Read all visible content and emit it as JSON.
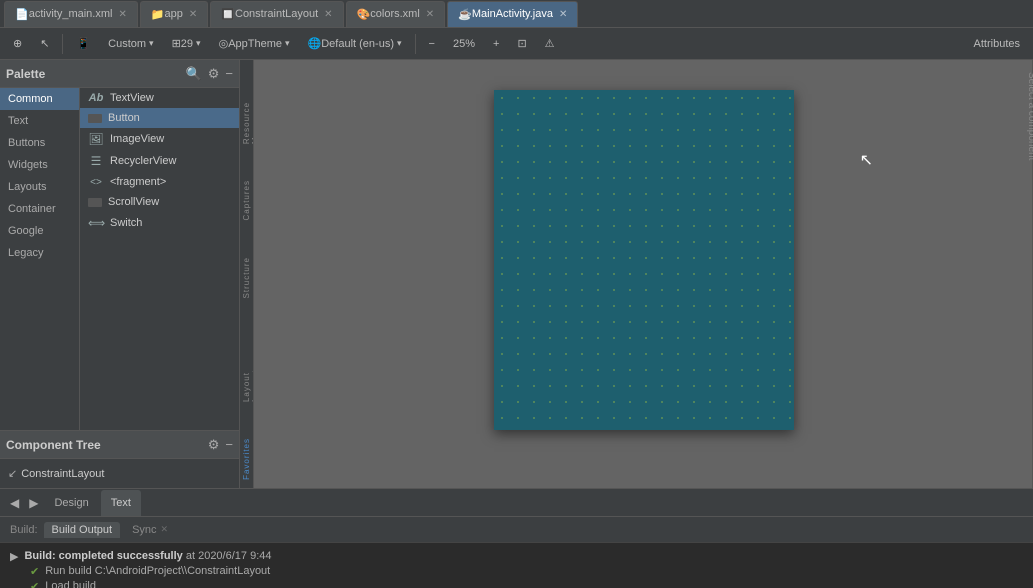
{
  "tabs": [
    {
      "label": "activity_main.xml",
      "icon": "📄",
      "active": false
    },
    {
      "label": "app",
      "icon": "📁",
      "active": false
    },
    {
      "label": "ConstraintLayout",
      "icon": "🔲",
      "active": false
    },
    {
      "label": "colors.xml",
      "icon": "🎨",
      "active": false
    },
    {
      "label": "MainActivity.java",
      "icon": "☕",
      "active": true
    }
  ],
  "toolbar": {
    "design_icon": "⊕",
    "cursor_icon": "↖",
    "custom_label": "Custom",
    "size_label": "29",
    "theme_label": "AppTheme",
    "locale_label": "Default (en-us)",
    "zoom_out": "−",
    "zoom_level": "25%",
    "zoom_in": "+",
    "zoom_fit": "⊡",
    "warning_icon": "⚠",
    "attributes_label": "Attributes"
  },
  "palette": {
    "title": "Palette",
    "search_icon": "🔍",
    "settings_icon": "⚙",
    "close_icon": "−",
    "categories": [
      {
        "label": "Common",
        "active": true
      },
      {
        "label": "Text"
      },
      {
        "label": "Buttons"
      },
      {
        "label": "Widgets"
      },
      {
        "label": "Layouts"
      },
      {
        "label": "Container"
      },
      {
        "label": "Google"
      },
      {
        "label": "Legacy"
      }
    ],
    "items": [
      {
        "label": "TextView",
        "icon": "Ab"
      },
      {
        "label": "Button",
        "icon": "☐",
        "active": true
      },
      {
        "label": "ImageView",
        "icon": "🖼"
      },
      {
        "label": "RecyclerView",
        "icon": "☰"
      },
      {
        "label": "<fragment>",
        "icon": "<>"
      },
      {
        "label": "ScrollView",
        "icon": "☐"
      },
      {
        "label": "Switch",
        "icon": "⟺"
      }
    ]
  },
  "component_tree": {
    "title": "Component Tree",
    "settings_icon": "⚙",
    "close_icon": "−",
    "items": [
      {
        "label": "ConstraintLayout",
        "indent": 0,
        "icon": "↙"
      }
    ]
  },
  "canvas": {
    "placeholder": "Select a component to see attributes"
  },
  "bottom_panel": {
    "tabs": [
      {
        "label": "Design",
        "active": false
      },
      {
        "label": "Text",
        "active": true
      }
    ],
    "build": {
      "label": "Build:",
      "output_tab": "Build Output",
      "sync_tab": "Sync",
      "lines": [
        {
          "type": "arrow",
          "text": "Build: completed successfully at 2020/6/17 9:44"
        },
        {
          "type": "check",
          "text": "Run build C:\\AndroidProject\\\\ConstraintLayout"
        },
        {
          "type": "check",
          "text": "Load build"
        }
      ]
    }
  },
  "vertical_tabs": [
    "Resource Manager",
    "Structure",
    "Captures",
    "Layout Inspector",
    "Favorites"
  ]
}
